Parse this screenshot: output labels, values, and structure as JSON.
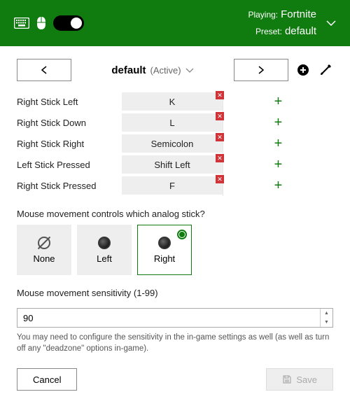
{
  "header": {
    "playing_label": "Playing:",
    "playing_value": "Fortnite",
    "preset_label": "Preset:",
    "preset_value": "default"
  },
  "preset": {
    "name": "default",
    "status": "(Active)"
  },
  "bindings": [
    {
      "action": "Right Stick Left",
      "key": "K"
    },
    {
      "action": "Right Stick Down",
      "key": "L"
    },
    {
      "action": "Right Stick Right",
      "key": "Semicolon"
    },
    {
      "action": "Left Stick Pressed",
      "key": "Shift Left"
    },
    {
      "action": "Right Stick Pressed",
      "key": "F"
    }
  ],
  "analog": {
    "question": "Mouse movement controls which analog stick?",
    "options": [
      "None",
      "Left",
      "Right"
    ],
    "selected": "Right"
  },
  "sensitivity": {
    "label": "Mouse movement sensitivity (1-99)",
    "value": "90",
    "hint": "You may need to configure the sensitivity in the in-game settings as well (as well as turn off any \"deadzone\" options in-game)."
  },
  "footer": {
    "cancel": "Cancel",
    "save": "Save"
  }
}
